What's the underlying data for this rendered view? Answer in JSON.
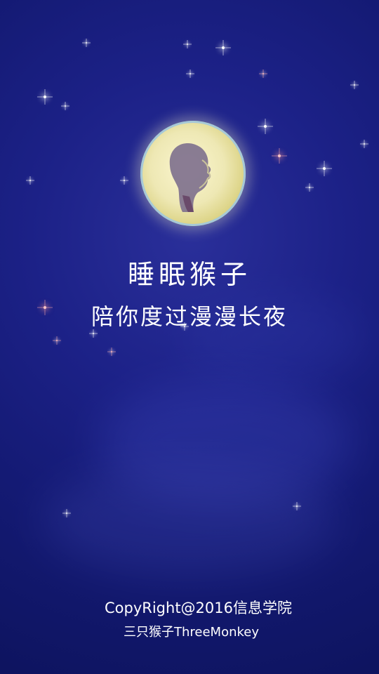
{
  "splash": {
    "app_title": "睡眠猴子",
    "tagline": "陪你度过漫漫长夜",
    "copyright": "CopyRight@2016信息学院",
    "team": "三只猴子ThreeMonkey"
  },
  "icons": {
    "moon": "moon-portrait-icon",
    "stars": "star-sparkle-icon"
  },
  "colors": {
    "background": "#1c2187",
    "text": "#ffffff",
    "moon": "#f3eebc"
  }
}
